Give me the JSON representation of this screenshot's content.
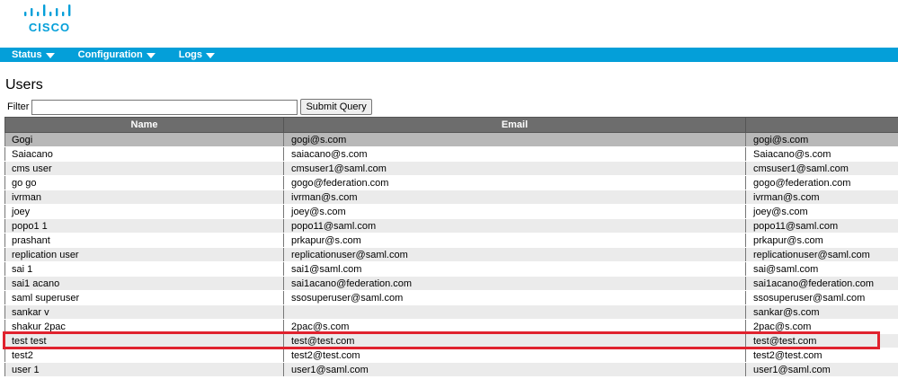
{
  "brand": {
    "logo_text": "CISCO",
    "color": "#049fd9"
  },
  "nav": {
    "items": [
      {
        "label": "Status",
        "icon": "caret-down-icon"
      },
      {
        "label": "Configuration",
        "icon": "caret-down-icon"
      },
      {
        "label": "Logs",
        "icon": "caret-down-icon"
      }
    ]
  },
  "page": {
    "title": "Users"
  },
  "filter": {
    "label": "Filter",
    "value": "",
    "placeholder": "",
    "submit_label": "Submit Query"
  },
  "table": {
    "headers": [
      "Name",
      "Email",
      ""
    ],
    "rows": [
      [
        "Gogi",
        "gogi@s.com",
        "gogi@s.com"
      ],
      [
        "Saiacano",
        "saiacano@s.com",
        "Saiacano@s.com"
      ],
      [
        "cms user",
        "cmsuser1@saml.com",
        "cmsuser1@saml.com"
      ],
      [
        "go go",
        "gogo@federation.com",
        "gogo@federation.com"
      ],
      [
        "ivrman",
        "ivrman@s.com",
        "ivrman@s.com"
      ],
      [
        "joey",
        "joey@s.com",
        "joey@s.com"
      ],
      [
        "popo1 1",
        "popo11@saml.com",
        "popo11@saml.com"
      ],
      [
        "prashant",
        "prkapur@s.com",
        "prkapur@s.com"
      ],
      [
        "replication user",
        "replicationuser@saml.com",
        "replicationuser@saml.com"
      ],
      [
        "sai 1",
        "sai1@saml.com",
        "sai@saml.com"
      ],
      [
        "sai1 acano",
        "sai1acano@federation.com",
        "sai1acano@federation.com"
      ],
      [
        "saml superuser",
        "ssosuperuser@saml.com",
        "ssosuperuser@saml.com"
      ],
      [
        "sankar v",
        "",
        "sankar@s.com"
      ],
      [
        "shakur 2pac",
        "2pac@s.com",
        "2pac@s.com"
      ],
      [
        "test test",
        "test@test.com",
        "test@test.com"
      ],
      [
        "test2",
        "test2@test.com",
        "test2@test.com"
      ],
      [
        "user 1",
        "user1@saml.com",
        "user1@saml.com"
      ]
    ]
  },
  "colors": {
    "nav_bg": "#049fd9",
    "header_bg": "#6d6d6d",
    "highlight": "#e0222e"
  }
}
